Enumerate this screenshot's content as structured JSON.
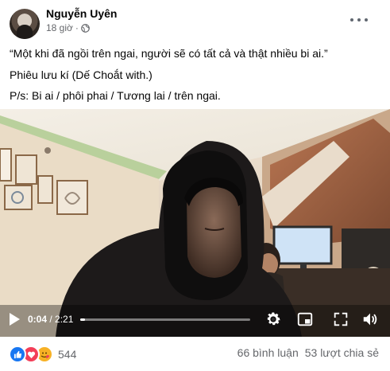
{
  "post": {
    "author": "Nguyễn Uyên",
    "time": "18 giờ",
    "separator": "·",
    "lines": [
      "“Một khi đã ngồi trên ngai, người sẽ có tất cả và thật nhiều bi ai.”",
      "Phiêu lưu kí (Dế Choắt with.)",
      "P/s: Bi ai / phôi phai / Tương lai / trên ngai."
    ]
  },
  "video": {
    "current_time": "0:04",
    "time_separator": " / ",
    "duration": "2:21",
    "progress": 0.028
  },
  "footer": {
    "reaction_count": "544",
    "comments": "66 bình luận",
    "shares": "53 lượt chia sẻ",
    "reactions": [
      "like-icon",
      "love-icon",
      "care-icon"
    ]
  },
  "colors": {
    "like": "#1877f2",
    "love": "#f33e58",
    "care": "#f7b125",
    "secondary_text": "#65676b"
  }
}
